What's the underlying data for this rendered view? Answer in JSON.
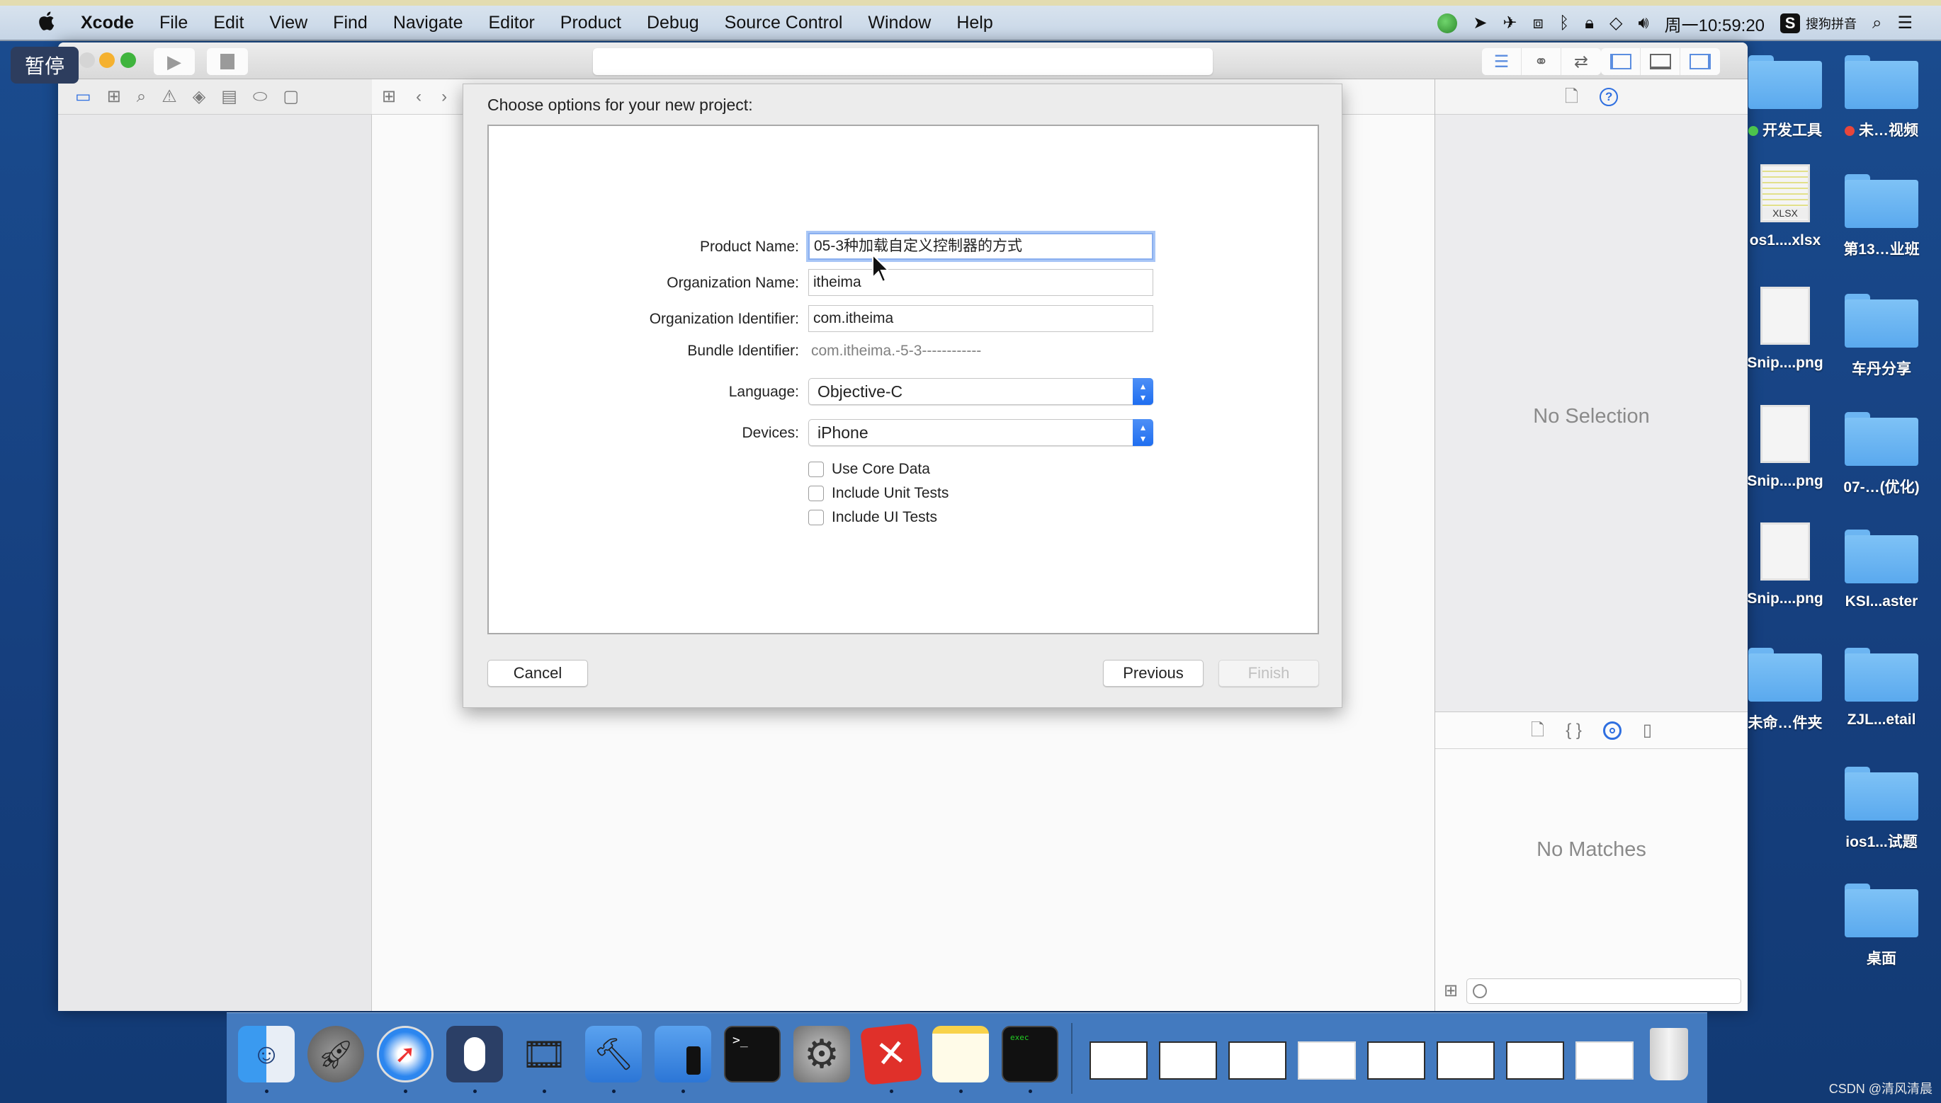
{
  "menubar": {
    "app_name": "Xcode",
    "items": [
      "File",
      "Edit",
      "View",
      "Find",
      "Navigate",
      "Editor",
      "Product",
      "Debug",
      "Source Control",
      "Window",
      "Help"
    ],
    "clock": "周一10:59:20",
    "input_method": "搜狗拼音",
    "status_icons": [
      "update-icon",
      "location-icon",
      "airplane-icon",
      "screen-record-icon",
      "bluetooth-icon",
      "lock-icon",
      "wifi-icon",
      "volume-icon"
    ]
  },
  "overlay": {
    "pause_label": "暂停"
  },
  "xcode": {
    "navigator_tabs": [
      "project-navigator",
      "symbol-navigator",
      "find-navigator",
      "issue-navigator",
      "test-navigator",
      "debug-navigator",
      "breakpoint-navigator",
      "report-navigator"
    ],
    "inspector": {
      "empty_text": "No Selection",
      "library_empty_text": "No Matches"
    }
  },
  "dialog": {
    "title": "Choose options for your new project:",
    "fields": {
      "product_name": {
        "label": "Product Name:",
        "value": "05-3种加载自定义控制器的方式"
      },
      "organization_name": {
        "label": "Organization Name:",
        "value": "itheima"
      },
      "organization_identifier": {
        "label": "Organization Identifier:",
        "value": "com.itheima"
      },
      "bundle_identifier": {
        "label": "Bundle Identifier:",
        "value": "com.itheima.-5-3------------"
      },
      "language": {
        "label": "Language:",
        "value": "Objective-C"
      },
      "devices": {
        "label": "Devices:",
        "value": "iPhone"
      }
    },
    "checkboxes": [
      {
        "label": "Use Core Data",
        "checked": false
      },
      {
        "label": "Include Unit Tests",
        "checked": false
      },
      {
        "label": "Include UI Tests",
        "checked": false
      }
    ],
    "buttons": {
      "cancel": "Cancel",
      "previous": "Previous",
      "finish": "Finish"
    }
  },
  "desktop": {
    "items": [
      {
        "label": "开发工具",
        "type": "folder",
        "tag": "#4cc44c"
      },
      {
        "label": "未…视频",
        "type": "folder",
        "tag": "#e8463b"
      },
      {
        "label": "os1....xlsx",
        "type": "xlsx"
      },
      {
        "label": "第13…业班",
        "type": "folder"
      },
      {
        "label": "Snip....png",
        "type": "png"
      },
      {
        "label": "车丹分享",
        "type": "folder"
      },
      {
        "label": "Snip....png",
        "type": "png"
      },
      {
        "label": "07-…(优化)",
        "type": "folder"
      },
      {
        "label": "Snip....png",
        "type": "png"
      },
      {
        "label": "KSI...aster",
        "type": "folder"
      },
      {
        "label": "未命…件夹",
        "type": "folder"
      },
      {
        "label": "ZJL...etail",
        "type": "folder"
      },
      {
        "label": "ios1...试题",
        "type": "folder"
      },
      {
        "label": "桌面",
        "type": "folder"
      }
    ],
    "xlsx_badge": "XLSX"
  },
  "dock": {
    "apps": [
      "Finder",
      "Launchpad",
      "Safari",
      "Mouse app",
      "Photo Slideshow",
      "Xcode",
      "Simulator",
      "Terminal",
      "System Preferences",
      "XMind",
      "Notes",
      "Console"
    ],
    "running": [
      true,
      false,
      true,
      true,
      true,
      true,
      true,
      false,
      false,
      true,
      true,
      true
    ]
  },
  "watermark": "CSDN @清风清晨"
}
